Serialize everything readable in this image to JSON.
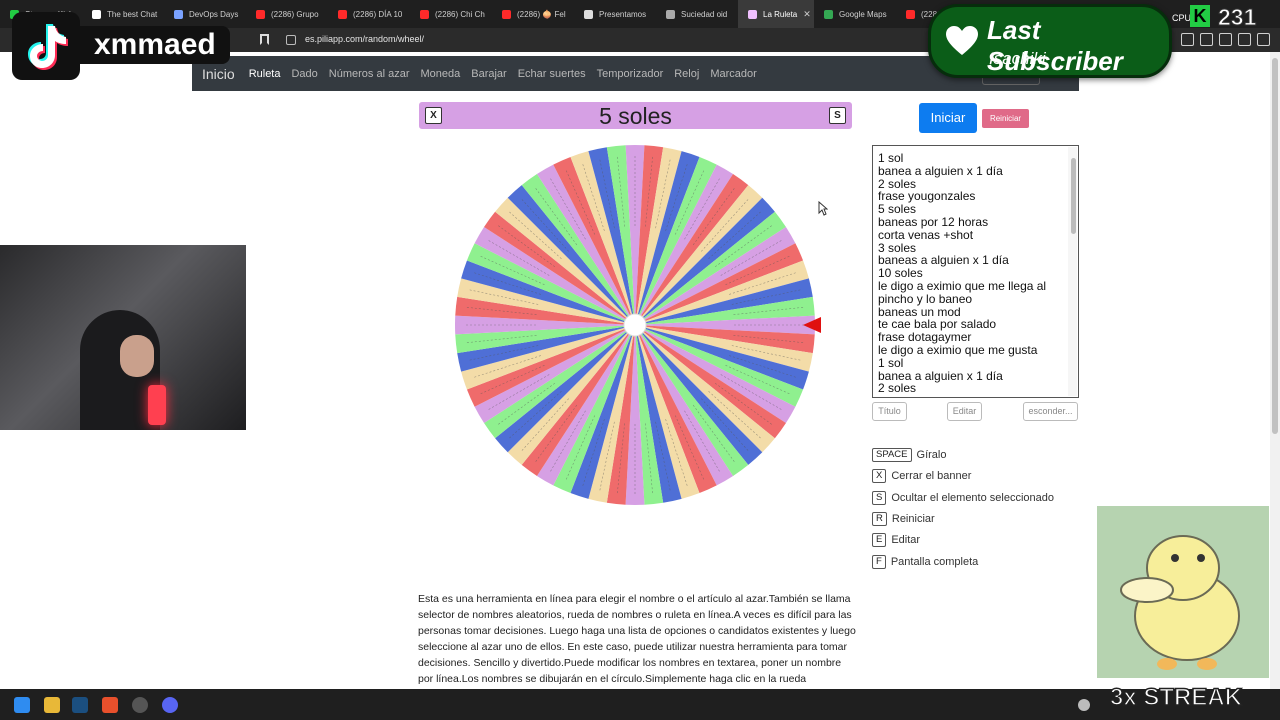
{
  "browser": {
    "tabs": [
      {
        "label": "Stream - Kick",
        "color": "#22cc44"
      },
      {
        "label": "The best Chat",
        "color": "#ffffff"
      },
      {
        "label": "DevOps Days",
        "color": "#7aa2ff"
      },
      {
        "label": "(2286) Grupo",
        "color": "#ff2a2a"
      },
      {
        "label": "(2286) DÍA 10",
        "color": "#ff2a2a"
      },
      {
        "label": "(2286) Chi Ch",
        "color": "#ff2a2a"
      },
      {
        "label": "(2286) 🧅 Fel",
        "color": "#ff2a2a"
      },
      {
        "label": "Presentamos",
        "color": "#dddddd"
      },
      {
        "label": "Suciedad oid",
        "color": "#aaaaaa"
      },
      {
        "label": "La Ruleta",
        "color": "#f0c0ff",
        "active": true
      },
      {
        "label": "Google Maps",
        "color": "#34a853"
      },
      {
        "label": "(2286)",
        "color": "#ff2a2a"
      }
    ],
    "url": "es.piliapp.com/random/wheel/"
  },
  "overlays": {
    "tiktok_name": "xmmaed",
    "last_subscriber_title": "Last Subscriber",
    "last_subscriber_name": "Isachiki",
    "cpu_label": "CPU",
    "k_label": "K",
    "viewer_count": "231",
    "streak": "3x STREAK"
  },
  "nav": {
    "brand": "Inicio",
    "items": [
      "Ruleta",
      "Dado",
      "Números al azar",
      "Moneda",
      "Barajar",
      "Echar suertes",
      "Temporizador",
      "Reloj",
      "Marcador"
    ],
    "active": "Ruleta"
  },
  "banner": {
    "title": "5 soles",
    "close_key": "X",
    "hide_key": "S",
    "color": "#d6a0e4"
  },
  "controls": {
    "start": "Iniciar",
    "reset": "Reiniciar",
    "title_button": "Título",
    "edit_button": "Editar",
    "hide_button": "esconder..."
  },
  "list_lines": [
    "1 sol",
    "banea a alguien x 1 día",
    "2 soles",
    "frase yougonzales",
    "5 soles",
    "baneas por 12 horas",
    "corta venas +shot",
    "3 soles",
    "baneas a alguien x 1 día",
    "10 soles",
    "le digo a eximio que me llega al",
    "pincho y lo baneo",
    "baneas un mod",
    "te cae bala por salado",
    "frase dotagaymer",
    "le digo a eximio que me gusta",
    "1 sol",
    "banea a alguien x 1 día",
    "2 soles"
  ],
  "shortcuts": [
    {
      "key": "SPACE",
      "label": "Gíralo"
    },
    {
      "key": "X",
      "label": "Cerrar el banner"
    },
    {
      "key": "S",
      "label": "Ocultar el elemento seleccionado"
    },
    {
      "key": "R",
      "label": "Reiniciar"
    },
    {
      "key": "E",
      "label": "Editar"
    },
    {
      "key": "F",
      "label": "Pantalla completa"
    }
  ],
  "description": "Esta es una herramienta en línea para elegir el nombre o el artículo al azar.También se llama selector de nombres aleatorios, rueda de nombres o ruleta en línea.A veces es difícil para las personas tomar decisiones. Luego haga una lista de opciones o candidatos existentes y luego seleccione al azar uno de ellos. En este caso, puede utilizar nuestra herramienta para tomar decisiones. Sencillo y divertido.Puede modificar los nombres en textarea, poner un nombre por línea.Los nombres se dibujarán en el círculo.Simplemente haga clic en la rueda",
  "wheel": {
    "segment_count": 60,
    "colors": [
      "#d6a0e4",
      "#ef6b6b",
      "#f3dca8",
      "#4f6fd6",
      "#8ff08f"
    ],
    "pointer_color": "#e01010"
  }
}
